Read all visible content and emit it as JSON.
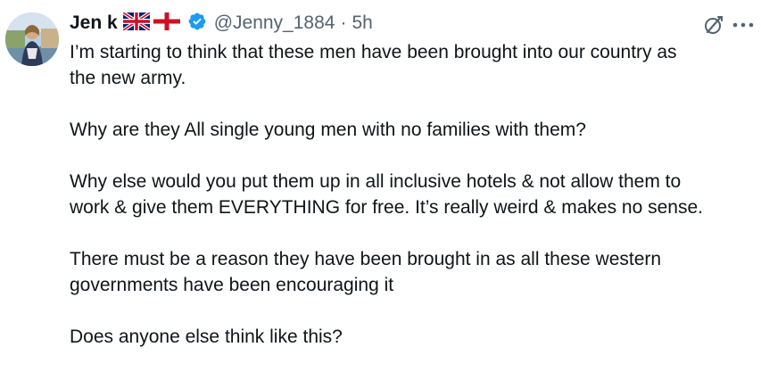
{
  "tweet": {
    "author": {
      "display_name": "Jen k",
      "flags": [
        "uk-flag-icon",
        "england-flag-icon"
      ],
      "verified": true,
      "handle": "@Jenny_1884",
      "separator": "·",
      "time": "5h"
    },
    "paragraphs": [
      {
        "lines": [
          "I’m starting to think that these men have been brought into our country as",
          "the new army."
        ]
      },
      {
        "lines": [
          "Why are they All single young men with no families with them?"
        ]
      },
      {
        "lines": [
          "Why else would you put them up in all inclusive hotels & not allow them to",
          "work & give them EVERYTHING for free. It’s really weird & makes no sense."
        ]
      },
      {
        "lines": [
          "There must be a reason they have been brought in as all these western",
          "governments have been encouraging it"
        ]
      },
      {
        "lines": [
          "Does anyone else think like this?"
        ]
      }
    ],
    "icons": {
      "grok": "grok-icon",
      "more": "more-options-icon"
    },
    "colors": {
      "text": "#0f1419",
      "secondary": "#536471",
      "verified": "#1d9bf0"
    }
  }
}
